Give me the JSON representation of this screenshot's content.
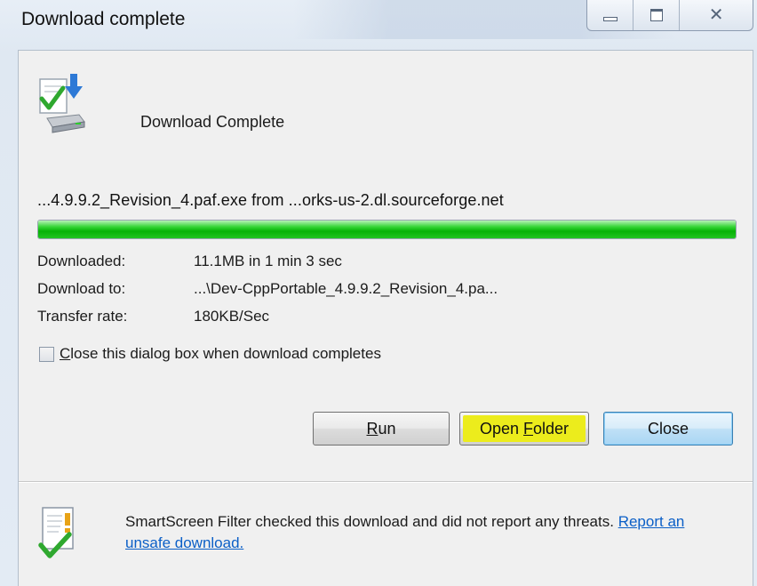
{
  "window": {
    "title": "Download complete",
    "caption_buttons": [
      "minimize-icon",
      "maximize-icon",
      "close-icon"
    ]
  },
  "header": {
    "icon": "download-complete-icon",
    "text": "Download Complete"
  },
  "download": {
    "filename": "...4.9.9.2_Revision_4.paf.exe from ...orks-us-2.dl.sourceforge.net",
    "progress_percent": 100,
    "progress_color": "#16c016",
    "details": [
      {
        "label": "Downloaded:",
        "value": "11.1MB in 1 min 3 sec"
      },
      {
        "label": "Download to:",
        "value": "...\\Dev-CppPortable_4.9.9.2_Revision_4.pa..."
      },
      {
        "label": "Transfer rate:",
        "value": "180KB/Sec"
      }
    ]
  },
  "checkbox": {
    "mnemonic": "C",
    "label_rest": "lose this dialog box when download completes",
    "checked": false
  },
  "buttons": {
    "run": {
      "mnemonic": "R",
      "rest": "un"
    },
    "open_folder": {
      "prefix": "Open ",
      "mnemonic": "F",
      "rest": "older",
      "highlight_color": "#f0f017"
    },
    "close": {
      "label": "Close"
    }
  },
  "smartscreen": {
    "icon": "smartscreen-icon",
    "text": "SmartScreen Filter checked this download and did not report any threats.",
    "link": "Report an unsafe download."
  }
}
